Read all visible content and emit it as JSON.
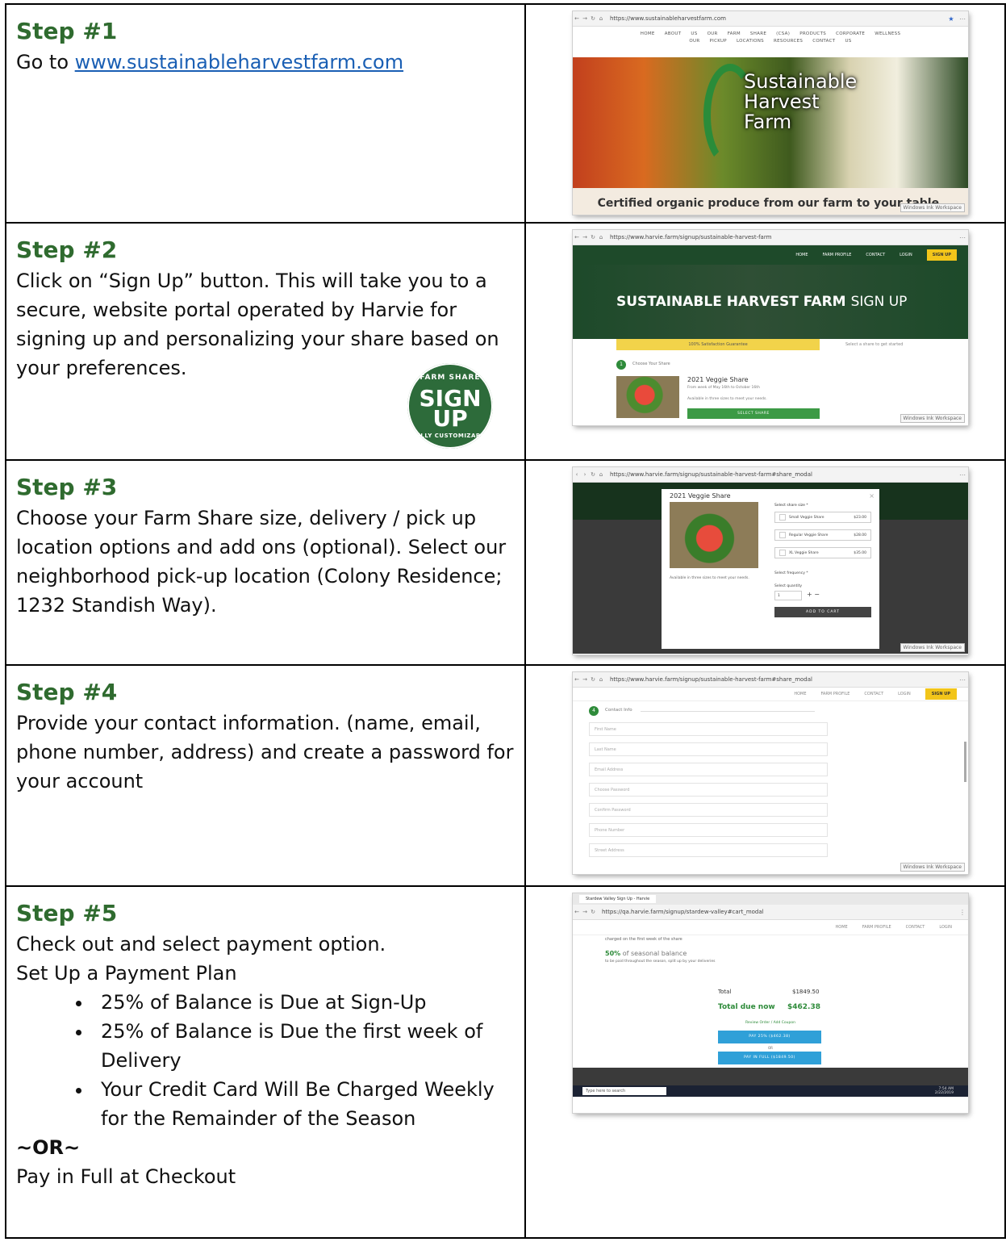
{
  "steps": [
    {
      "heading": "Step #1",
      "text_before": "Go to ",
      "link": "www.sustainableharvestfarm.com"
    },
    {
      "heading": "Step #2",
      "text": "Click on “Sign Up” button. This will take you to a secure, website portal operated by Harvie for signing up and personalizing your share based on your preferences.",
      "badge": {
        "top": "FARM SHARE",
        "line1": "SIGN",
        "line2": "UP",
        "bottom": "FULLY CUSTOMIZABLE"
      }
    },
    {
      "heading": "Step #3",
      "text": "Choose your Farm Share size, delivery / pick up location options and add ons (optional).  Select our neighborhood pick-up location (Colony Residence; 1232 Standish Way)."
    },
    {
      "heading": "Step #4",
      "text": "Provide your contact information. (name, email, phone number, address) and create a password for your account"
    },
    {
      "heading": "Step #5",
      "line1": "Check out and select payment option.",
      "line2": "Set Up a Payment Plan",
      "bullets": [
        "25% of Balance is Due at Sign-Up",
        "25% of Balance is Due the first week of Delivery",
        "Your Credit Card Will Be Charged Weekly for the Remainder of the Season"
      ],
      "or": "~OR~",
      "last": "Pay in Full at Checkout"
    }
  ],
  "shots": {
    "s1": {
      "url": "https://www.sustainableharvestfarm.com",
      "nav1": "HOME  ABOUT US  OUR FARM SHARE (CSA)  PRODUCTS  CORPORATE WELLNESS",
      "nav2": "OUR PICKUP LOCATIONS  RESOURCES  CONTACT US",
      "logo1": "Sustainable",
      "logo2": "Harvest",
      "logo3": "Farm",
      "caption": "Certified organic produce from our farm to your table."
    },
    "s2": {
      "url": "https://www.harvie.farm/signup/sustainable-harvest-farm",
      "nav": [
        "HOME",
        "FARM PROFILE",
        "CONTACT",
        "LOGIN",
        "SIGN UP"
      ],
      "hero_bold": "SUSTAINABLE HARVEST FARM",
      "hero_rest": "SIGN UP",
      "guarantee": "100% Satisfaction Guarantee",
      "select_hint": "Select a share to get started",
      "step_num": "1",
      "choose": "Choose Your Share",
      "share_title": "2021 Veggie Share",
      "share_sub1": "From week of May 16th to October 16th",
      "share_sub2": "Available in three sizes to meet your needs.",
      "button": "SELECT SHARE"
    },
    "s3": {
      "url": "https://www.harvie.farm/signup/sustainable-harvest-farm#share_modal",
      "title": "2021 Veggie Share",
      "select_size": "Select share size *",
      "options": [
        {
          "name": "Small Veggie Share",
          "price": "$23.00"
        },
        {
          "name": "Regular Veggie Share",
          "price": "$28.00"
        },
        {
          "name": "XL Veggie Share",
          "price": "$35.00"
        }
      ],
      "avail": "Available in three sizes to meet your needs.",
      "freq": "Select frequency *",
      "qty": "Select quantity",
      "qty_val": "1",
      "plusminus": "+  −",
      "add": "ADD TO CART"
    },
    "s4": {
      "url": "https://www.harvie.farm/signup/sustainable-harvest-farm#share_modal",
      "nav": [
        "HOME",
        "FARM PROFILE",
        "CONTACT",
        "LOGIN",
        "SIGN UP"
      ],
      "step_num": "4",
      "label": "Contact Info",
      "fields": [
        "First Name",
        "Last Name",
        "Email Address",
        "Choose Password",
        "Confirm Password",
        "Phone Number",
        "Street Address"
      ]
    },
    "s5": {
      "tab": "Stardew Valley Sign Up - Harvie",
      "url": "https://qa.harvie.farm/signup/stardew-valley#cart_modal",
      "nav": [
        "HOME",
        "FARM PROFILE",
        "CONTACT",
        "LOGIN"
      ],
      "charged": "charged on the first week of the share",
      "bal_pct": "50%",
      "bal_rest": " of seasonal balance",
      "bal_sub": "to be paid throughout the season, split up by your deliveries",
      "total_label": "Total",
      "total_value": "$1849.50",
      "due_label": "Total due now",
      "due_value": "$462.38",
      "review": "Review Order / Add Coupon",
      "pay25": "PAY 25% ($462.38)",
      "or": "OR",
      "payfull": "PAY IN FULL ($1849.50)",
      "search": "Type here to search",
      "time": "7:54 AM",
      "date": "2/22/2019"
    },
    "watermark": "Windows Ink Workspace"
  }
}
